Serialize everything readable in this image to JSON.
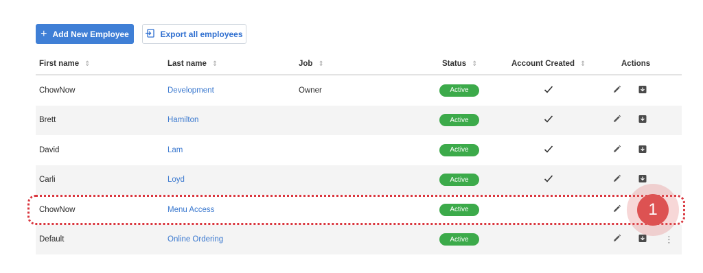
{
  "toolbar": {
    "add_button_label": "Add New Employee",
    "export_button_label": "Export all employees"
  },
  "table": {
    "columns": [
      {
        "label": "First name",
        "sortable": true
      },
      {
        "label": "Last name",
        "sortable": true
      },
      {
        "label": "Job",
        "sortable": true
      },
      {
        "label": "Status",
        "sortable": true
      },
      {
        "label": "Account Created",
        "sortable": true
      },
      {
        "label": "Actions",
        "sortable": false
      }
    ],
    "rows": [
      {
        "first_name": "ChowNow",
        "last_name": "Development",
        "job": "Owner",
        "status": "Active",
        "account_created": true
      },
      {
        "first_name": "Brett",
        "last_name": "Hamilton",
        "job": "",
        "status": "Active",
        "account_created": true
      },
      {
        "first_name": "David",
        "last_name": "Lam",
        "job": "",
        "status": "Active",
        "account_created": true
      },
      {
        "first_name": "Carli",
        "last_name": "Loyd",
        "job": "",
        "status": "Active",
        "account_created": true
      },
      {
        "first_name": "ChowNow",
        "last_name": "Menu Access",
        "job": "",
        "status": "Active",
        "account_created": false
      },
      {
        "first_name": "Default",
        "last_name": "Online Ordering",
        "job": "",
        "status": "Active",
        "account_created": false
      }
    ]
  },
  "annotation": {
    "marker_label": "1",
    "highlighted_row_index": 4
  },
  "colors": {
    "primary": "#3f7fd6",
    "link": "#3b79cf",
    "status_active": "#3caa4a",
    "annotation": "#dd5252"
  },
  "icons": {
    "add": "plus-icon",
    "export": "export-icon",
    "sort": "sort-icon",
    "check": "check-icon",
    "edit": "pencil-icon",
    "archive": "archive-icon",
    "more": "more-vertical-icon"
  }
}
